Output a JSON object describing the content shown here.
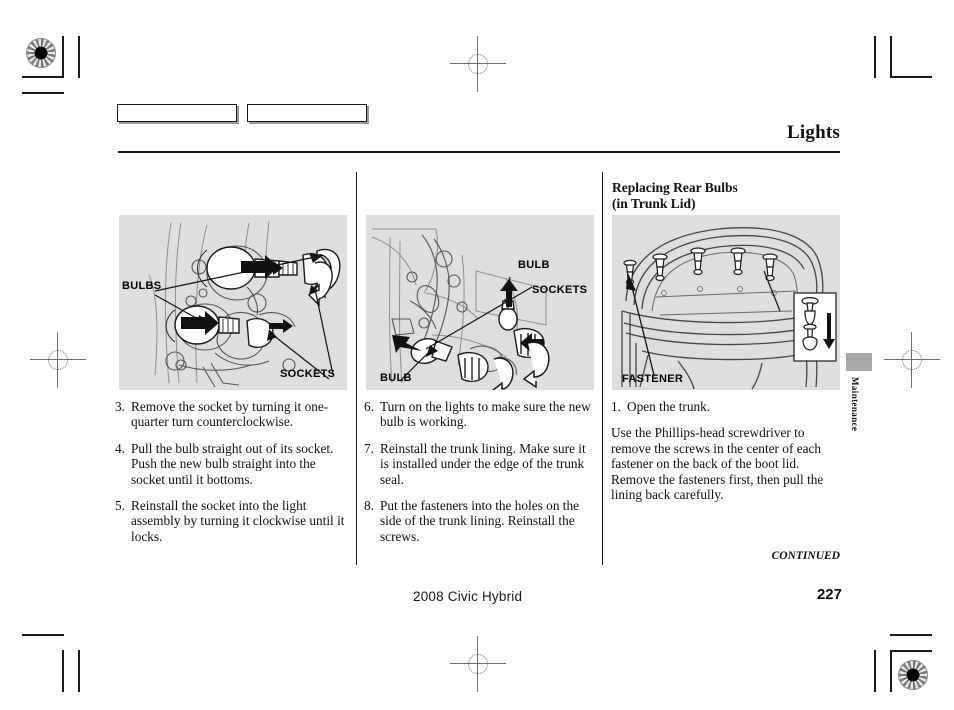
{
  "header": {
    "title": "Lights",
    "tab_boxes": [
      "",
      ""
    ]
  },
  "columns": {
    "left": {
      "illustration": {
        "labels": [
          {
            "name": "bulbs",
            "text": "BULBS"
          },
          {
            "name": "sockets",
            "text": "SOCKETS"
          }
        ]
      },
      "steps": [
        {
          "num": "3.",
          "text": "Remove the socket by turning it one-quarter turn counterclockwise."
        },
        {
          "num": "4.",
          "text": "Pull the bulb straight out of its socket. Push the new bulb straight into the socket until it bottoms."
        },
        {
          "num": "5.",
          "text": "Reinstall the socket into the light assembly by turning it clockwise until it locks."
        }
      ]
    },
    "middle": {
      "illustration": {
        "labels": [
          {
            "name": "bulb-top",
            "text": "BULB"
          },
          {
            "name": "sockets",
            "text": "SOCKETS"
          },
          {
            "name": "bulb-bottom",
            "text": "BULB"
          }
        ]
      },
      "steps": [
        {
          "num": "6.",
          "text": "Turn on the lights to make sure the new bulb is working."
        },
        {
          "num": "7.",
          "text": "Reinstall the trunk lining. Make sure it is installed under the edge of the trunk seal."
        },
        {
          "num": "8.",
          "text": "Put the fasteners into the holes on the side of the trunk lining. Reinstall the screws."
        }
      ]
    },
    "right": {
      "heading": "Replacing Rear Bulbs\n(in Trunk Lid)",
      "illustration": {
        "labels": [
          {
            "name": "fastener",
            "text": "FASTENER"
          }
        ]
      },
      "steps": [
        {
          "num": "1.",
          "text": "Open the trunk."
        }
      ],
      "paragraphs": [
        "Use the Phillips-head screwdriver to remove the screws in the center of each fastener on the back of the boot lid. Remove the fasteners first, then pull the lining back carefully."
      ],
      "continued": "CONTINUED"
    }
  },
  "side_tab": {
    "label": "Maintenance"
  },
  "footer": {
    "model": "2008  Civic  Hybrid",
    "page_number": "227"
  },
  "colors": {
    "illustration_background": "#dedede",
    "side_tab": "#a8a8a8",
    "text": "#111111"
  }
}
